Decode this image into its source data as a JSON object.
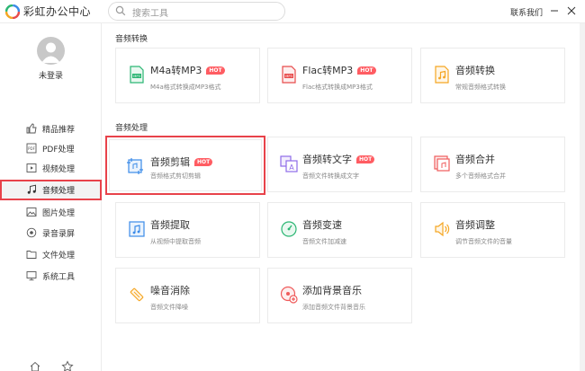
{
  "app": {
    "title": "彩虹办公中心",
    "contact": "联系我们"
  },
  "search": {
    "placeholder": "搜索工具"
  },
  "user": {
    "login_label": "未登录"
  },
  "nav": [
    {
      "label": "精品推荐",
      "icon": "thumbs-up-icon"
    },
    {
      "label": "PDF处理",
      "icon": "pdf-icon"
    },
    {
      "label": "视频处理",
      "icon": "video-icon"
    },
    {
      "label": "音频处理",
      "icon": "music-note-icon",
      "active": true
    },
    {
      "label": "图片处理",
      "icon": "image-icon"
    },
    {
      "label": "录音录屏",
      "icon": "record-icon"
    },
    {
      "label": "文件处理",
      "icon": "folder-icon"
    },
    {
      "label": "系统工具",
      "icon": "monitor-icon"
    }
  ],
  "sections": [
    {
      "title": "音频转换",
      "cards": [
        {
          "title": "M4a转MP3",
          "desc": "M4a格式转换成MP3格式",
          "hot": "HOT",
          "icon": "m4a-to-mp3-icon",
          "color": "#2bb673"
        },
        {
          "title": "Flac转MP3",
          "desc": "Flac格式转换成MP3格式",
          "hot": "HOT",
          "icon": "flac-to-mp3-icon",
          "color": "#e84c4c"
        },
        {
          "title": "音频转换",
          "desc": "常规音频格式转换",
          "icon": "audio-convert-icon",
          "color": "#f5a623"
        }
      ]
    },
    {
      "title": "音频处理",
      "cards": [
        {
          "title": "音频剪辑",
          "desc": "音频格式剪切剪辑",
          "hot": "HOT",
          "icon": "audio-cut-icon",
          "color": "#3b8be8",
          "highlight": true
        },
        {
          "title": "音频转文字",
          "desc": "音频文件转换成文字",
          "hot": "HOT",
          "icon": "audio-to-text-icon",
          "color": "#8e6be8"
        },
        {
          "title": "音频合并",
          "desc": "多个音频格式合并",
          "icon": "audio-merge-icon",
          "color": "#ef5b5b"
        },
        {
          "title": "音频提取",
          "desc": "从视频中提取音频",
          "icon": "audio-extract-icon",
          "color": "#3b8be8"
        },
        {
          "title": "音频变速",
          "desc": "音频文件加减速",
          "icon": "audio-speed-icon",
          "color": "#2bb673"
        },
        {
          "title": "音频调整",
          "desc": "调节音频文件的音量",
          "icon": "volume-adjust-icon",
          "color": "#f5a623"
        },
        {
          "title": "噪音消除",
          "desc": "音频文件降噪",
          "icon": "noise-remove-icon",
          "color": "#f5a623"
        },
        {
          "title": "添加背景音乐",
          "desc": "添加音频文件背景音乐",
          "icon": "add-bgm-icon",
          "color": "#ef5b5b"
        }
      ]
    }
  ]
}
